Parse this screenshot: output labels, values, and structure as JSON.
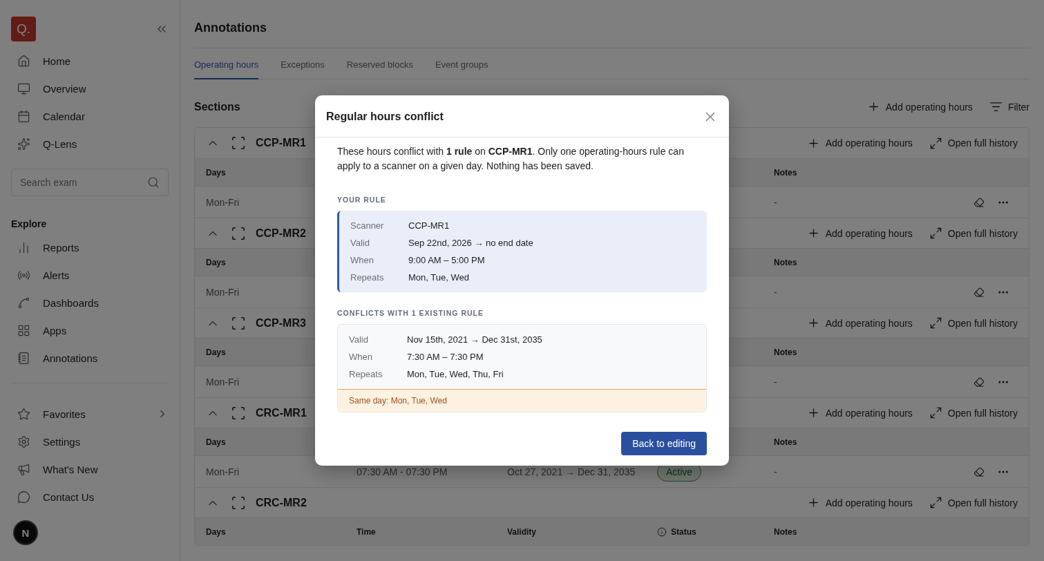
{
  "sidebar": {
    "logo": "Q.",
    "search": {
      "placeholder": "Search exam"
    },
    "primary": [
      {
        "kind": "home",
        "label": "Home"
      },
      {
        "kind": "overview",
        "label": "Overview"
      },
      {
        "kind": "calendar",
        "label": "Calendar"
      },
      {
        "kind": "lens",
        "label": "Q-Lens"
      }
    ],
    "explore_heading": "Explore",
    "explore": [
      {
        "kind": "reports",
        "label": "Reports"
      },
      {
        "kind": "alerts",
        "label": "Alerts"
      },
      {
        "kind": "dashboards",
        "label": "Dashboards"
      },
      {
        "kind": "apps",
        "label": "Apps"
      },
      {
        "kind": "annotations",
        "label": "Annotations"
      }
    ],
    "secondary": [
      {
        "kind": "favorites",
        "label": "Favorites",
        "expandable": true
      },
      {
        "kind": "settings",
        "label": "Settings",
        "expandable": false
      },
      {
        "kind": "news",
        "label": "What's New",
        "expandable": false
      },
      {
        "kind": "contact",
        "label": "Contact Us",
        "expandable": false
      }
    ],
    "dev_badge": "N"
  },
  "main": {
    "title": "Annotations",
    "tabs": [
      {
        "label": "Operating hours",
        "selected": true
      },
      {
        "label": "Exceptions",
        "selected": false
      },
      {
        "label": "Reserved blocks",
        "selected": false
      },
      {
        "label": "Event groups",
        "selected": false
      }
    ],
    "sections_heading": "Sections",
    "toolbar": [
      {
        "kind": "add",
        "label": "Add operating hours"
      },
      {
        "kind": "filter",
        "label": "Filter"
      }
    ],
    "sections": [
      {
        "name": "CCP-MR1",
        "expanded": true,
        "actions": [
          {
            "kind": "add",
            "label": "Add operating hours"
          },
          {
            "kind": "history",
            "label": "Open full history"
          }
        ],
        "columns": [
          {
            "kind": "days",
            "label": "Days"
          },
          {
            "kind": "notes",
            "label": "Notes"
          }
        ],
        "rows": [
          {
            "cells": [
              {
                "kind": "days",
                "text": "Mon-Fri"
              },
              {
                "kind": "notes",
                "text": "-"
              }
            ]
          }
        ]
      },
      {
        "name": "CCP-MR2",
        "expanded": true,
        "actions": [
          {
            "kind": "add",
            "label": "Add operating hours"
          },
          {
            "kind": "history",
            "label": "Open full history"
          }
        ],
        "columns": [
          {
            "kind": "days",
            "label": "Days"
          },
          {
            "kind": "notes",
            "label": "Notes"
          }
        ],
        "rows": [
          {
            "cells": [
              {
                "kind": "days",
                "text": "Mon-Fri"
              },
              {
                "kind": "notes",
                "text": "-"
              }
            ]
          }
        ]
      },
      {
        "name": "CCP-MR3",
        "expanded": true,
        "actions": [
          {
            "kind": "add",
            "label": "Add operating hours"
          },
          {
            "kind": "history",
            "label": "Open full history"
          }
        ],
        "columns": [
          {
            "kind": "days",
            "label": "Days"
          },
          {
            "kind": "notes",
            "label": "Notes"
          }
        ],
        "rows": [
          {
            "cells": [
              {
                "kind": "days",
                "text": "Mon-Fri"
              },
              {
                "kind": "notes",
                "text": "-"
              }
            ]
          }
        ]
      },
      {
        "name": "CRC-MR1",
        "expanded": true,
        "actions": [
          {
            "kind": "add",
            "label": "Add operating hours"
          },
          {
            "kind": "history",
            "label": "Open full history"
          }
        ],
        "columns": [
          {
            "kind": "days",
            "label": "Days"
          },
          {
            "kind": "time"
          },
          {
            "kind": "validity"
          },
          {
            "kind": "status"
          },
          {
            "kind": "notes",
            "label": "Notes"
          }
        ],
        "rows": [
          {
            "cells": [
              {
                "kind": "days",
                "text": "Mon-Fri"
              },
              {
                "kind": "time",
                "text": "07:30 AM - 07:30 PM"
              },
              {
                "kind": "validity",
                "text": "Oct 27, 2021 → Dec 31, 2035"
              },
              {
                "kind": "status",
                "text": "Active"
              },
              {
                "kind": "notes",
                "text": "-"
              }
            ]
          }
        ]
      },
      {
        "name": "CRC-MR2",
        "expanded": true,
        "actions": [
          {
            "kind": "add",
            "label": "Add operating hours"
          },
          {
            "kind": "history",
            "label": "Open full history"
          }
        ],
        "columns": [
          {
            "kind": "days",
            "label": "Days"
          },
          {
            "kind": "time",
            "label": "Time"
          },
          {
            "kind": "validity",
            "label": "Validity"
          },
          {
            "kind": "status",
            "label": "Status"
          },
          {
            "kind": "notes",
            "label": "Notes"
          }
        ]
      }
    ]
  },
  "dialog": {
    "title": "Regular hours conflict",
    "message": "These hours conflict with **1 rule** on **CCP-MR1**. Only one operating-hours rule can apply to a scanner on a given day. Nothing has been saved.",
    "your_rule": {
      "heading": "YOUR RULE",
      "fields": [
        {
          "label": "Scanner",
          "value": "CCP-MR1"
        },
        {
          "label": "Valid",
          "value": "Sep 22nd, 2026 → no end date"
        },
        {
          "label": "When",
          "value": "9:00 AM – 5:00 PM"
        },
        {
          "label": "Repeats",
          "value": "Mon, Tue, Wed"
        }
      ]
    },
    "conflicts": {
      "heading": "CONFLICTS WITH 1 EXISTING RULE",
      "rules": [
        {
          "fields": [
            {
              "label": "Valid",
              "value": "Nov 15th, 2021 → Dec 31st, 2035"
            },
            {
              "label": "When",
              "value": "7:30 AM – 7:30 PM"
            },
            {
              "label": "Repeats",
              "value": "Mon, Tue, Wed, Thu, Fri"
            }
          ],
          "overlap": "Same day: Mon, Tue, Wed"
        }
      ]
    },
    "button": "Back to editing"
  }
}
